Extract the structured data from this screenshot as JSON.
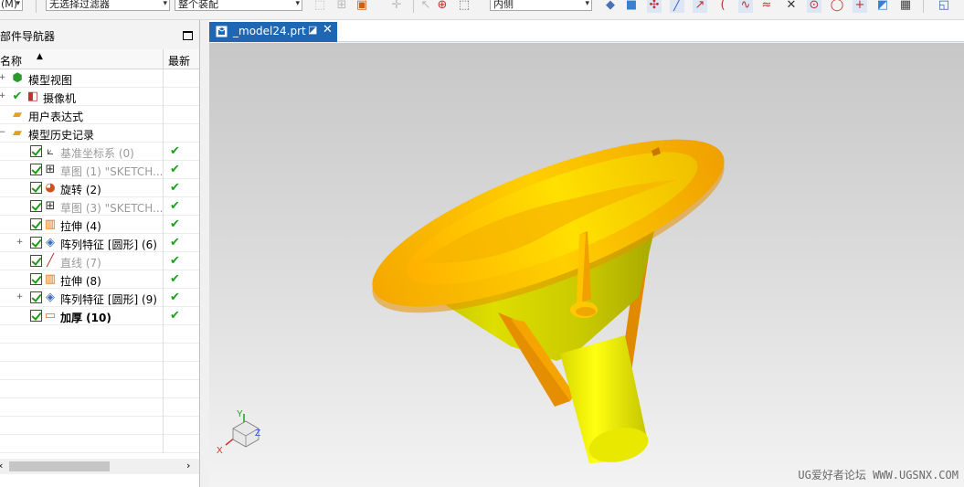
{
  "toolbar": {
    "combo_left": "(M)",
    "filter_combo": "无选择过滤器",
    "scope_combo": "整个装配",
    "mode_combo": "内侧"
  },
  "navigator": {
    "title": "部件导航器",
    "col_name": "名称",
    "col_latest": "最新",
    "items": [
      {
        "label": "模型视图",
        "icon": "model-views-icon"
      },
      {
        "label": "摄像机",
        "icon": "camera-icon"
      },
      {
        "label": "用户表达式",
        "icon": "folder-icon"
      },
      {
        "label": "模型历史记录",
        "icon": "folder-open-icon"
      },
      {
        "label": "基准坐标系 (0)",
        "icon": "datum-csys-icon"
      },
      {
        "label": "草图 (1) \"SKETCH...",
        "icon": "sketch-icon"
      },
      {
        "label": "旋转 (2)",
        "icon": "revolve-icon"
      },
      {
        "label": "草图 (3) \"SKETCH...",
        "icon": "sketch-icon"
      },
      {
        "label": "拉伸 (4)",
        "icon": "extrude-icon"
      },
      {
        "label": "阵列特征 [圆形] (6)",
        "icon": "pattern-icon"
      },
      {
        "label": "直线 (7)",
        "icon": "line-icon"
      },
      {
        "label": "拉伸 (8)",
        "icon": "extrude-icon"
      },
      {
        "label": "阵列特征 [圆形] (9)",
        "icon": "pattern-icon"
      },
      {
        "label": "加厚 (10)",
        "icon": "thicken-icon"
      }
    ]
  },
  "graphics": {
    "tab_name": "_model24.prt",
    "watermark": "UG爱好者论坛 WWW.UGSNX.COM",
    "triad": {
      "x": "X",
      "y": "Y",
      "z": "Z"
    }
  },
  "colors": {
    "model_orange": "#f5a000",
    "model_yellow": "#e8e800",
    "tab_blue": "#1e67b4",
    "ok_green": "#1aa21a"
  }
}
